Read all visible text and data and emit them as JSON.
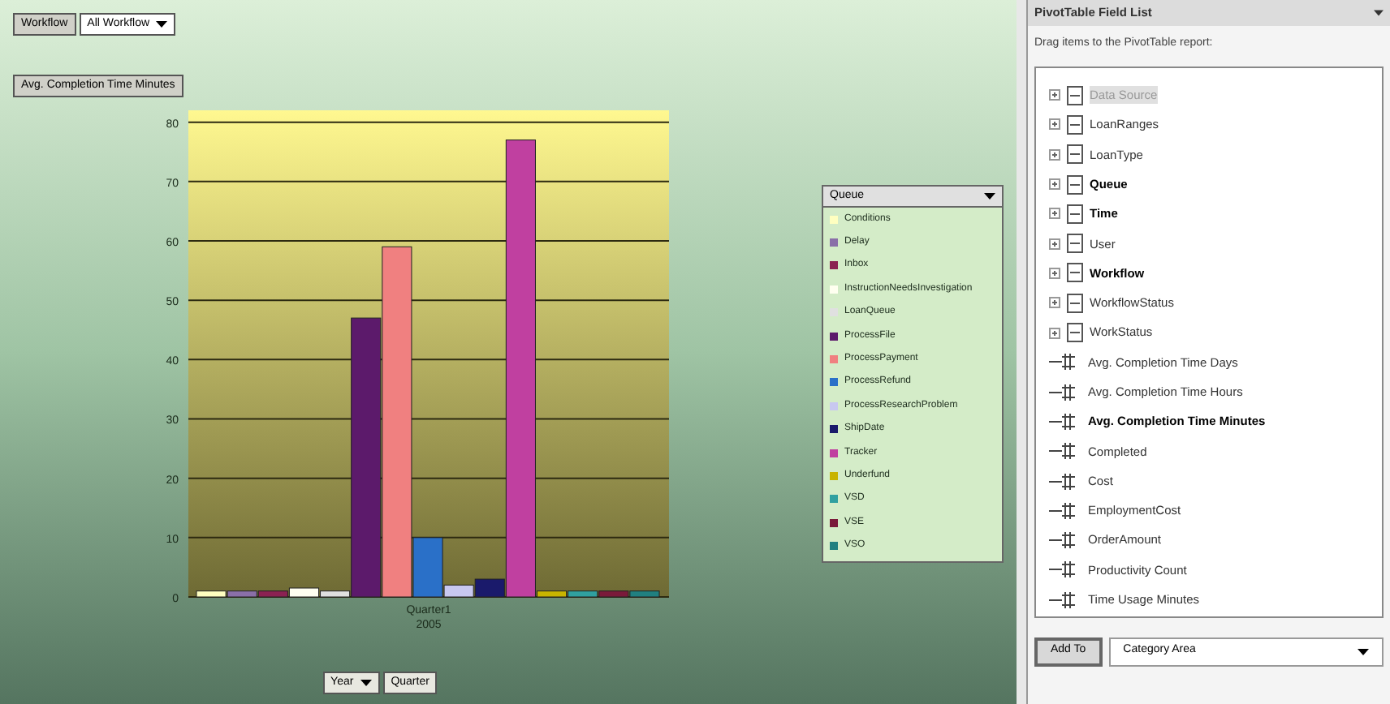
{
  "toolbar": {
    "filter_button": "Workflow",
    "filter_value": "All Workflow"
  },
  "chart": {
    "data_field_button": "Avg. Completion Time Minutes",
    "legend_title": "Queue",
    "chart_data": {
      "type": "bar",
      "grid": true,
      "categories": [
        "Quarter1 2005"
      ],
      "ylim": [
        0,
        82
      ],
      "yticks": [
        0,
        10,
        20,
        30,
        40,
        50,
        60,
        70,
        80
      ],
      "series": [
        {
          "name": "Conditions",
          "color": "#ffffc0",
          "values": [
            1
          ]
        },
        {
          "name": "Delay",
          "color": "#8a6fa8",
          "values": [
            1
          ]
        },
        {
          "name": "Inbox",
          "color": "#8b2252",
          "values": [
            1
          ]
        },
        {
          "name": "InstructionNeedsInvestigation",
          "color": "#fffff0",
          "values": [
            1.5
          ]
        },
        {
          "name": "LoanQueue",
          "color": "#e0e0e0",
          "values": [
            1
          ]
        },
        {
          "name": "ProcessFile",
          "color": "#5c1a6b",
          "values": [
            47
          ]
        },
        {
          "name": "ProcessPayment",
          "color": "#f08080",
          "values": [
            59
          ]
        },
        {
          "name": "ProcessRefund",
          "color": "#2a70c8",
          "values": [
            10
          ]
        },
        {
          "name": "ProcessResearchProblem",
          "color": "#c8c8f0",
          "values": [
            2
          ]
        },
        {
          "name": "ShipDate",
          "color": "#1a1a6b",
          "values": [
            3
          ]
        },
        {
          "name": "Tracker",
          "color": "#c040a0",
          "values": [
            77
          ]
        },
        {
          "name": "Underfund",
          "color": "#c8b400",
          "values": [
            1
          ]
        },
        {
          "name": "VSD",
          "color": "#30a0a0",
          "values": [
            1
          ]
        },
        {
          "name": "VSE",
          "color": "#7a1a3a",
          "values": [
            1
          ]
        },
        {
          "name": "VSO",
          "color": "#208080",
          "values": [
            1
          ]
        }
      ]
    },
    "axis_buttons": [
      "Year",
      "Quarter"
    ]
  },
  "field_list": {
    "title": "PivotTable Field List",
    "instruction": "Drag items to the PivotTable report:",
    "fields": [
      {
        "kind": "dimension",
        "label": "Data Source",
        "used": false,
        "disabled": true
      },
      {
        "kind": "dimension",
        "label": "LoanRanges",
        "used": false,
        "disabled": false
      },
      {
        "kind": "dimension",
        "label": "LoanType",
        "used": false,
        "disabled": false
      },
      {
        "kind": "dimension",
        "label": "Queue",
        "used": true,
        "disabled": false
      },
      {
        "kind": "dimension",
        "label": "Time",
        "used": true,
        "disabled": false
      },
      {
        "kind": "dimension",
        "label": "User",
        "used": false,
        "disabled": false
      },
      {
        "kind": "dimension",
        "label": "Workflow",
        "used": true,
        "disabled": false
      },
      {
        "kind": "dimension",
        "label": "WorkflowStatus",
        "used": false,
        "disabled": false
      },
      {
        "kind": "dimension",
        "label": "WorkStatus",
        "used": false,
        "disabled": false
      },
      {
        "kind": "measure",
        "label": "Avg. Completion Time Days",
        "used": false,
        "disabled": false
      },
      {
        "kind": "measure",
        "label": "Avg. Completion Time Hours",
        "used": false,
        "disabled": false
      },
      {
        "kind": "measure",
        "label": "Avg. Completion Time Minutes",
        "used": true,
        "disabled": false
      },
      {
        "kind": "measure",
        "label": "Completed",
        "used": false,
        "disabled": false
      },
      {
        "kind": "measure",
        "label": "Cost",
        "used": false,
        "disabled": false
      },
      {
        "kind": "measure",
        "label": "EmploymentCost",
        "used": false,
        "disabled": false
      },
      {
        "kind": "measure",
        "label": "OrderAmount",
        "used": false,
        "disabled": false
      },
      {
        "kind": "measure",
        "label": "Productivity Count",
        "used": false,
        "disabled": false
      },
      {
        "kind": "measure",
        "label": "Time Usage Minutes",
        "used": false,
        "disabled": false
      }
    ],
    "add_button": "Add To",
    "area_select": "Category Area"
  }
}
